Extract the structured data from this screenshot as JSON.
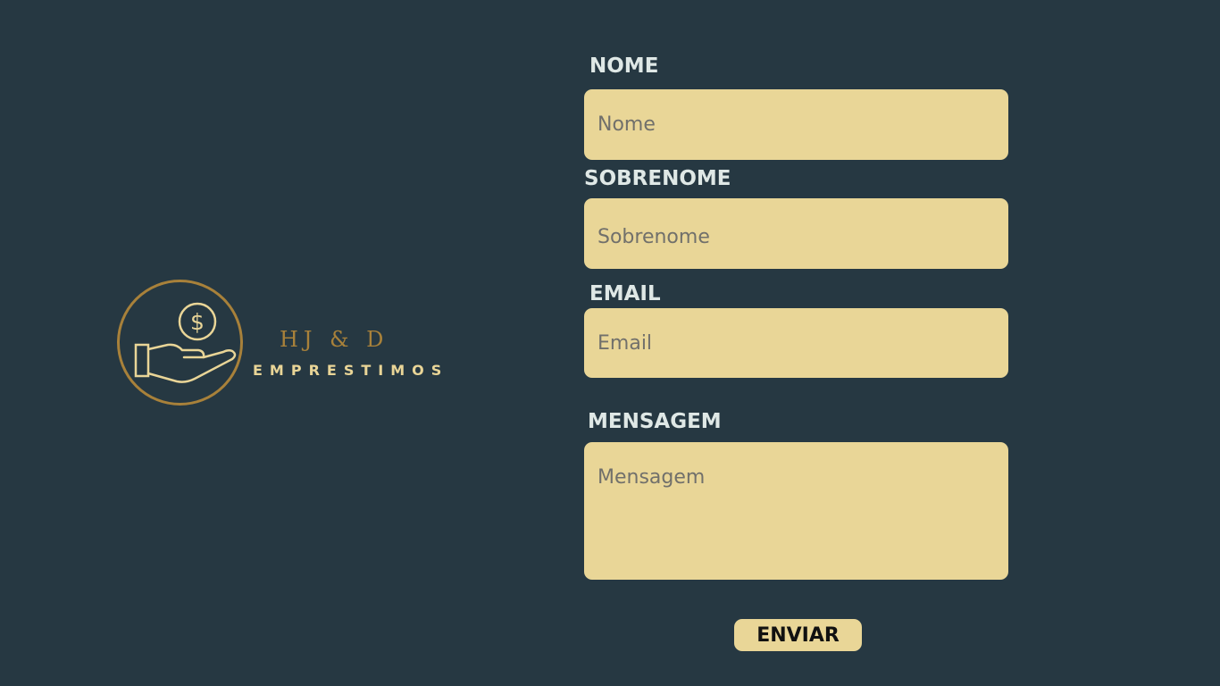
{
  "brand": {
    "name_top": "HJ & D",
    "name_bottom": "EMPRESTIMOS",
    "icon": "hand-holding-dollar-icon"
  },
  "form": {
    "nome": {
      "label": "NOME",
      "placeholder": "Nome",
      "value": ""
    },
    "sobrenome": {
      "label": "SOBRENOME",
      "placeholder": "Sobrenome",
      "value": ""
    },
    "email": {
      "label": "EMAIL",
      "placeholder": "Email",
      "value": ""
    },
    "mensagem": {
      "label": "MENSAGEM",
      "placeholder": "Mensagem",
      "value": ""
    },
    "submit_label": "ENVIAR"
  },
  "colors": {
    "background": "#263842",
    "field": "#e9d697",
    "gold": "#a8813a",
    "label": "#dfe8e6"
  }
}
